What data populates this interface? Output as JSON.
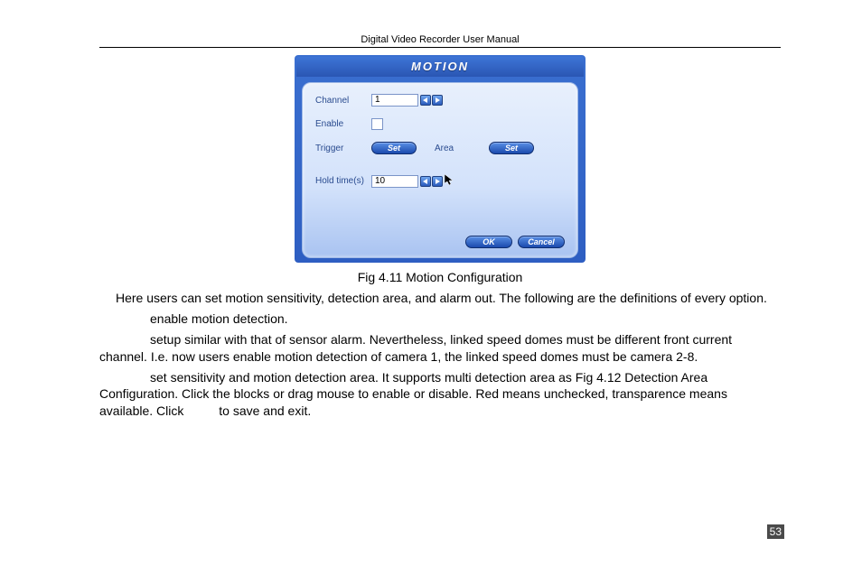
{
  "header": {
    "title": "Digital Video Recorder User Manual"
  },
  "dialog": {
    "title": "MOTION",
    "channel": {
      "label": "Channel",
      "value": "1"
    },
    "enable": {
      "label": "Enable"
    },
    "trigger": {
      "label": "Trigger",
      "set": "Set"
    },
    "area": {
      "label": "Area",
      "set": "Set"
    },
    "hold": {
      "label": "Hold time(s)",
      "value": "10"
    },
    "ok": "OK",
    "cancel": "Cancel"
  },
  "caption": "Fig 4.11    Motion Configuration",
  "paragraphs": {
    "p1": "Here users can set motion sensitivity, detection area, and alarm out. The following are the definitions of every option.",
    "p2": "enable motion detection.",
    "p3": "setup similar with that of sensor alarm. Nevertheless, linked speed domes must be different front current channel. I.e. now users enable motion detection of camera 1, the linked speed domes must be camera 2-8.",
    "p4a": "set sensitivity and motion detection area. It supports multi detection area as Fig 4.12    Detection Area Configuration. Click the blocks or drag mouse to enable or disable. Red means unchecked, transparence means available. Click",
    "p4b": "to save and exit."
  },
  "pagenum": "53"
}
